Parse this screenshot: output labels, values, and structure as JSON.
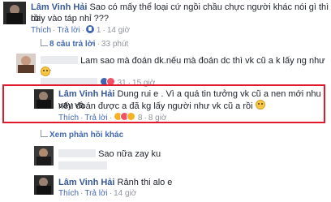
{
  "comments": [
    {
      "author": "Lâm Vinh Hải",
      "text_line1": "Sao có mấy thể loại cứ ngồi chầu chực người khác nói gì thì rồi",
      "text_line2": "bay vào táp nhỉ ???",
      "action_like": "Thích",
      "action_reply": "Trả lời",
      "like_count": "1",
      "time": "14 giờ"
    },
    {
      "text": "Lam sao mà đoán dk.nếu mà đoán dc thì vk cũ a k lấy ng như a r",
      "action_like": "Thích",
      "action_reply": "Trả lời",
      "reaction_count": "31",
      "time": "15 giờ"
    },
    {
      "author": "Lâm Vinh Hải",
      "text_line1": "Dung rui e . Vì a quá tin tưởng vk cũ a nen mới nhu vay và",
      "text_line2": "nếu đoán được a đã kg lấy người như vk cũ a rồi",
      "action_like": "Thích",
      "action_reply": "Trả lời",
      "reaction_count": "8",
      "time": "8 giờ"
    },
    {
      "text": "Sao nữa zay ku",
      "action_like": "Thích",
      "action_reply": "Trả lời"
    },
    {
      "author": "Lâm Vinh Hải",
      "text": "Rảnh thi alo e",
      "action_like": "Thích",
      "action_reply": "Trả lời",
      "time": "14 giờ"
    }
  ],
  "replies_link_1": "8 câu trả lời",
  "replies_1_time": "33 phút",
  "more_replies": "Xem phản hồi khác",
  "colors": {
    "link": "#365899",
    "meta": "#90949c",
    "highlight": "#e1192b"
  }
}
